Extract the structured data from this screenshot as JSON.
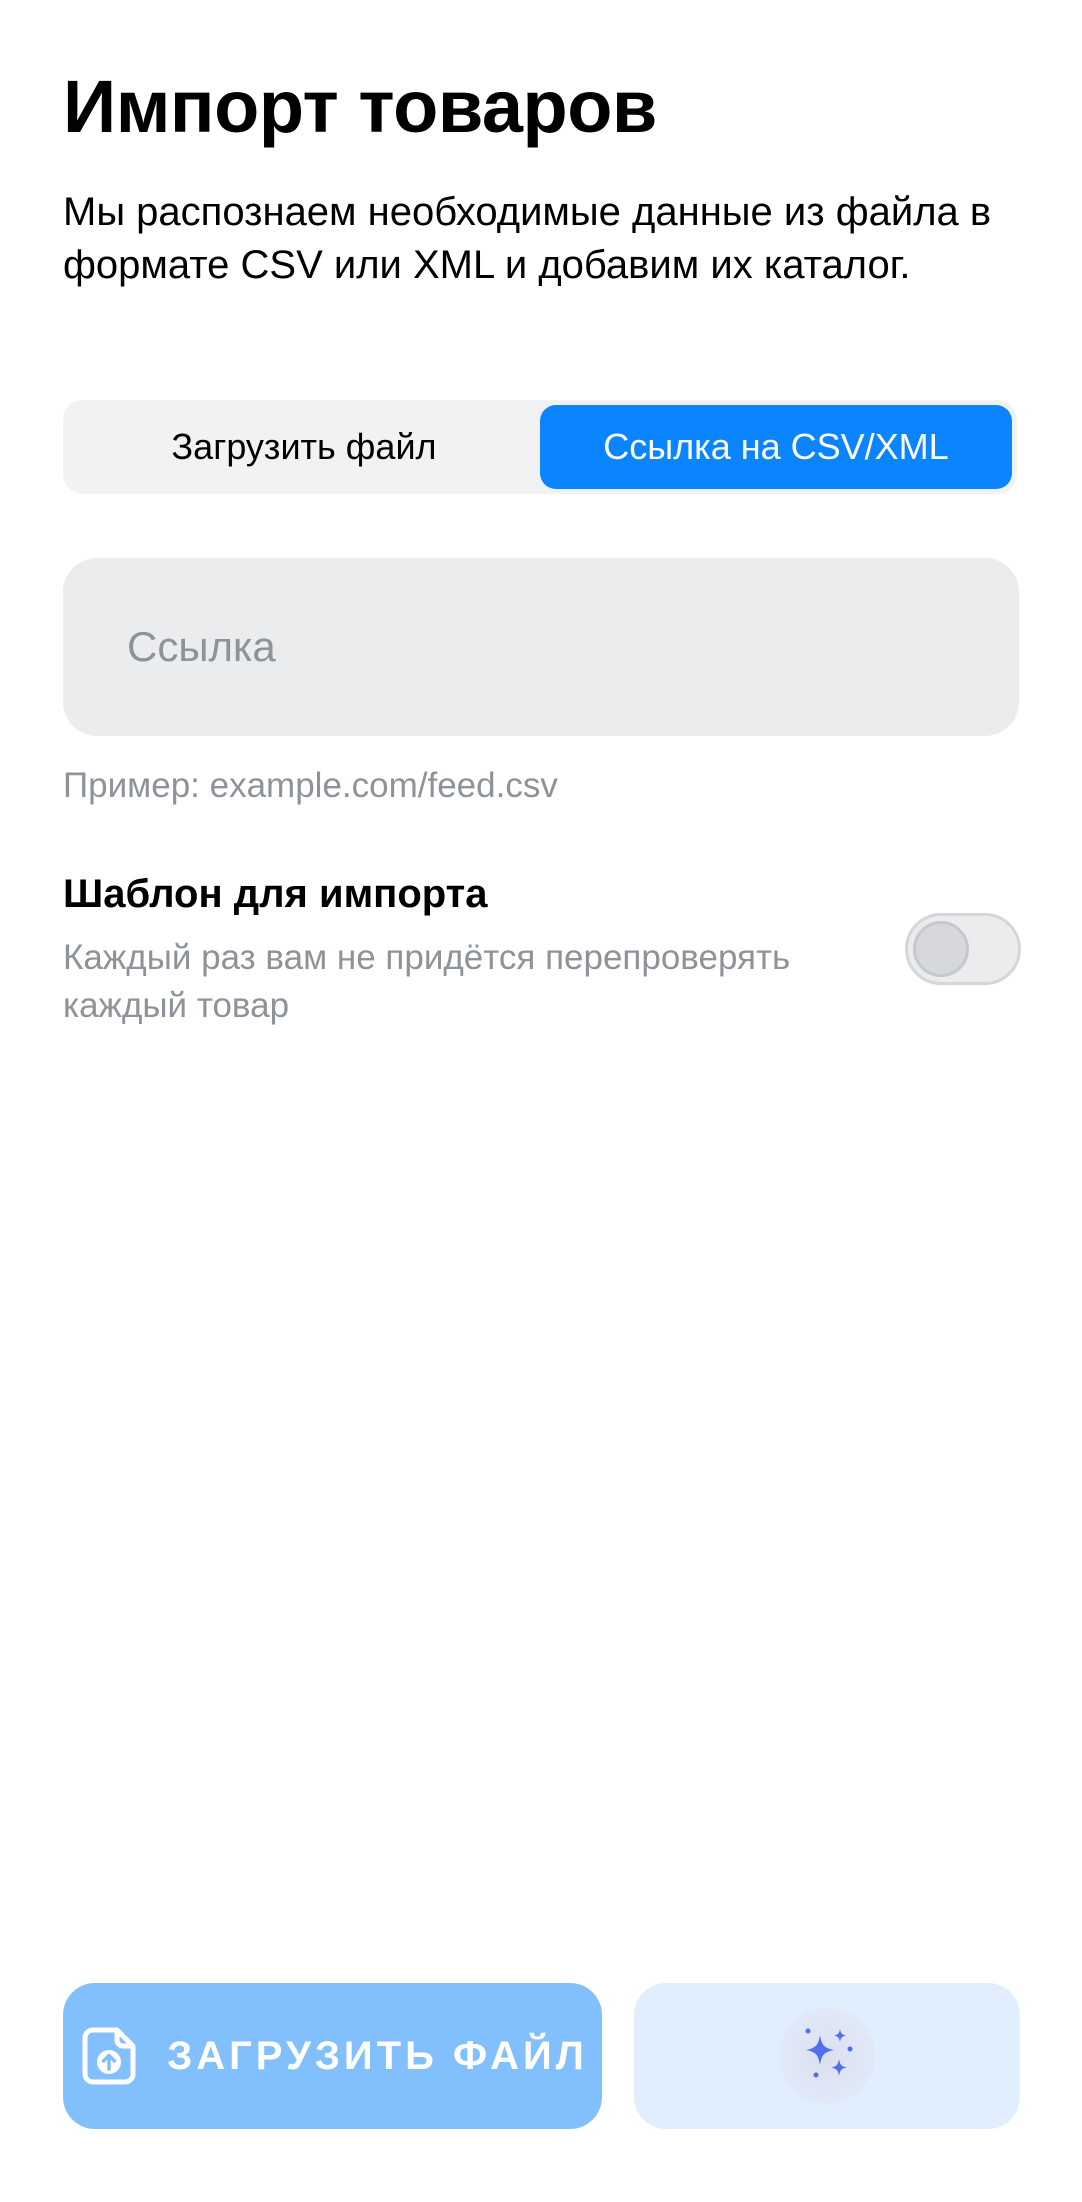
{
  "header": {
    "title": "Импорт товаров",
    "description": "Мы распознаем необходимые данные из файла в формате CSV или XML и добавим их каталог."
  },
  "segmented": {
    "tabs": [
      {
        "label": "Загрузить файл",
        "active": false
      },
      {
        "label": "Ссылка на CSV/XML",
        "active": true
      }
    ]
  },
  "link_field": {
    "value": "",
    "placeholder": "Ссылка",
    "hint": "Пример: example.com/feed.csv"
  },
  "template": {
    "title": "Шаблон для импорта",
    "subtitle": "Каждый раз вам не придётся перепроверять каждый товар",
    "enabled": false
  },
  "actions": {
    "upload_label": "ЗАГРУЗИТЬ ФАЙЛ",
    "upload_icon": "file-upload-icon",
    "ai_icon": "sparkles-icon"
  },
  "colors": {
    "accent": "#0a84ff",
    "upload_button_bg": "#82c0fd",
    "ai_button_bg": "#e1eefd",
    "secondary_text": "#8e939a",
    "field_bg": "#ebecee",
    "sparkle": "#4f6ef0"
  }
}
